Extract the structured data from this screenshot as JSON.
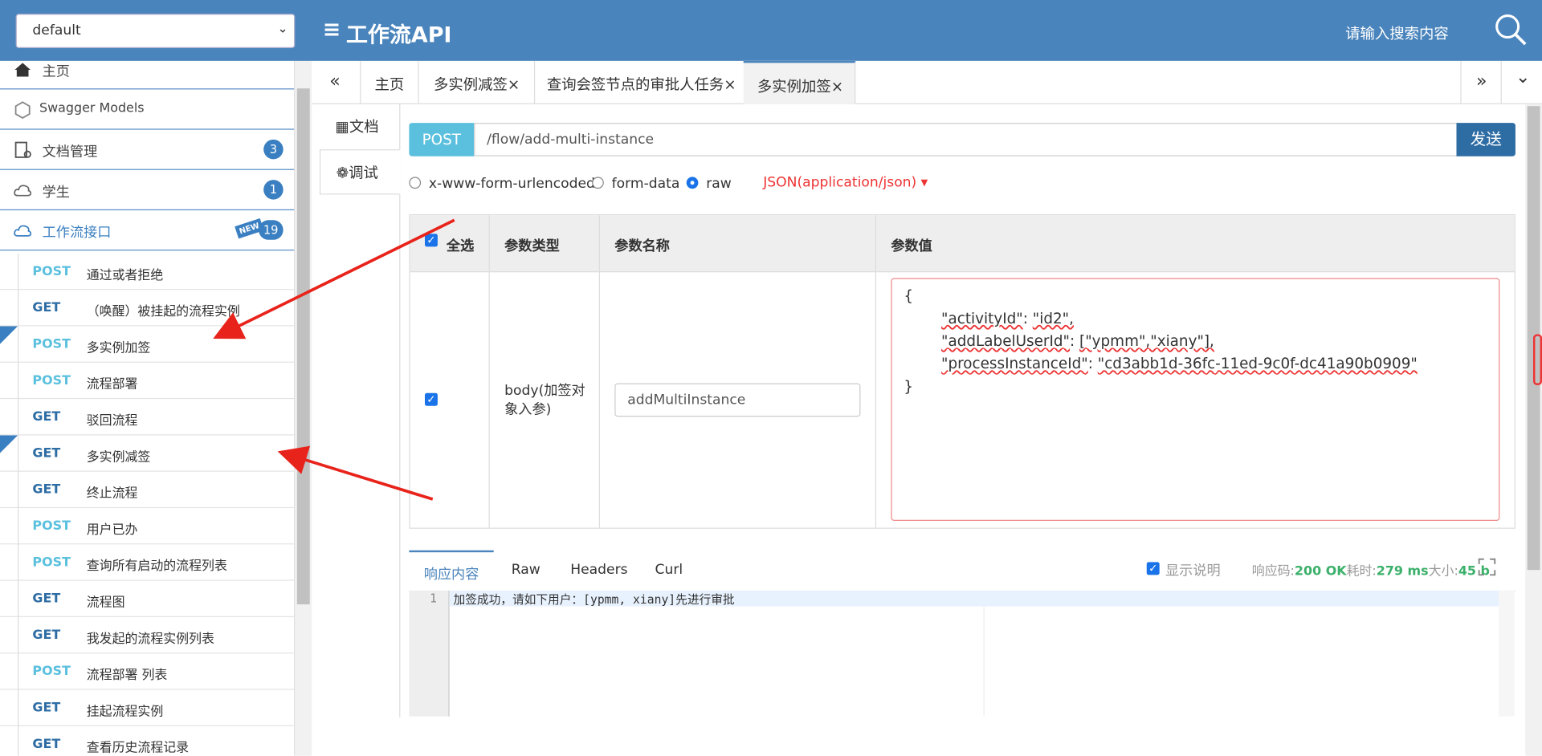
{
  "header": {
    "group": "default",
    "title": "工作流API",
    "search_placeholder": "请输入搜索内容"
  },
  "sidebar": {
    "nav": [
      {
        "label": "主页"
      },
      {
        "label": "Swagger Models"
      },
      {
        "label": "文档管理",
        "badge": "3"
      },
      {
        "label": "学生",
        "badge": "1"
      },
      {
        "label": "工作流接口",
        "badge": "19",
        "new_badge": "NEW"
      }
    ],
    "apis": [
      {
        "method": "POST",
        "name": "通过或者拒绝"
      },
      {
        "method": "GET",
        "name": "（唤醒）被挂起的流程实例"
      },
      {
        "method": "POST",
        "name": "多实例加签",
        "new": true
      },
      {
        "method": "POST",
        "name": "流程部署"
      },
      {
        "method": "GET",
        "name": "驳回流程"
      },
      {
        "method": "GET",
        "name": "多实例减签",
        "new": true
      },
      {
        "method": "GET",
        "name": "终止流程"
      },
      {
        "method": "POST",
        "name": "用户已办"
      },
      {
        "method": "POST",
        "name": "查询所有启动的流程列表"
      },
      {
        "method": "GET",
        "name": "流程图"
      },
      {
        "method": "GET",
        "name": "我发起的流程实例列表"
      },
      {
        "method": "POST",
        "name": "流程部署 列表"
      },
      {
        "method": "GET",
        "name": "挂起流程实例"
      },
      {
        "method": "GET",
        "name": "查看历史流程记录"
      }
    ]
  },
  "tabs": {
    "prev": "«",
    "next": "»",
    "more": "⌄",
    "items": [
      {
        "label": "主页"
      },
      {
        "label": "多实例减签×"
      },
      {
        "label": "查询会签节点的审批人任务×"
      },
      {
        "label": "多实例加签×"
      }
    ]
  },
  "side_tabs": {
    "doc": "文档",
    "debug": "调试"
  },
  "request": {
    "method": "POST",
    "url": "/flow/add-multi-instance",
    "send": "发送",
    "modes": [
      "x-www-form-urlencoded",
      "form-data",
      "raw"
    ],
    "selected_mode": "raw",
    "content_type": "JSON(application/json)"
  },
  "params": {
    "headers": {
      "select_all": "全选",
      "type": "参数类型",
      "name": "参数名称",
      "value": "参数值"
    },
    "row": {
      "type": "body(加签对象入参)",
      "name": "addMultiInstance"
    },
    "json_lines": {
      "l1": "{",
      "l2k": "\"activityId\"",
      "l2v": "\"id2\",",
      "l3k": "\"addLabelUserId\"",
      "l3v": "[\"ypmm\",\"xiany\"],",
      "l4k": "\"processInstanceId\"",
      "l4v": "\"cd3abb1d-36fc-11ed-9c0f-dc41a90b0909\"",
      "l5": "}"
    }
  },
  "response": {
    "tabs": [
      "响应内容",
      "Raw",
      "Headers",
      "Curl"
    ],
    "show_desc": "显示说明",
    "code_label": "响应码:",
    "code": "200 OK",
    "time_label": "耗时:",
    "time": "279 ms",
    "size_label": "大小:",
    "size": "45 b",
    "line_no": "1",
    "body": "加签成功，请如下用户：[ypmm, xiany]先进行审批"
  },
  "colors": {
    "header": "#4a84bc",
    "post": "#5bc0de",
    "get": "#2e6da4",
    "send": "#2e6da4",
    "accent": "#e33"
  }
}
